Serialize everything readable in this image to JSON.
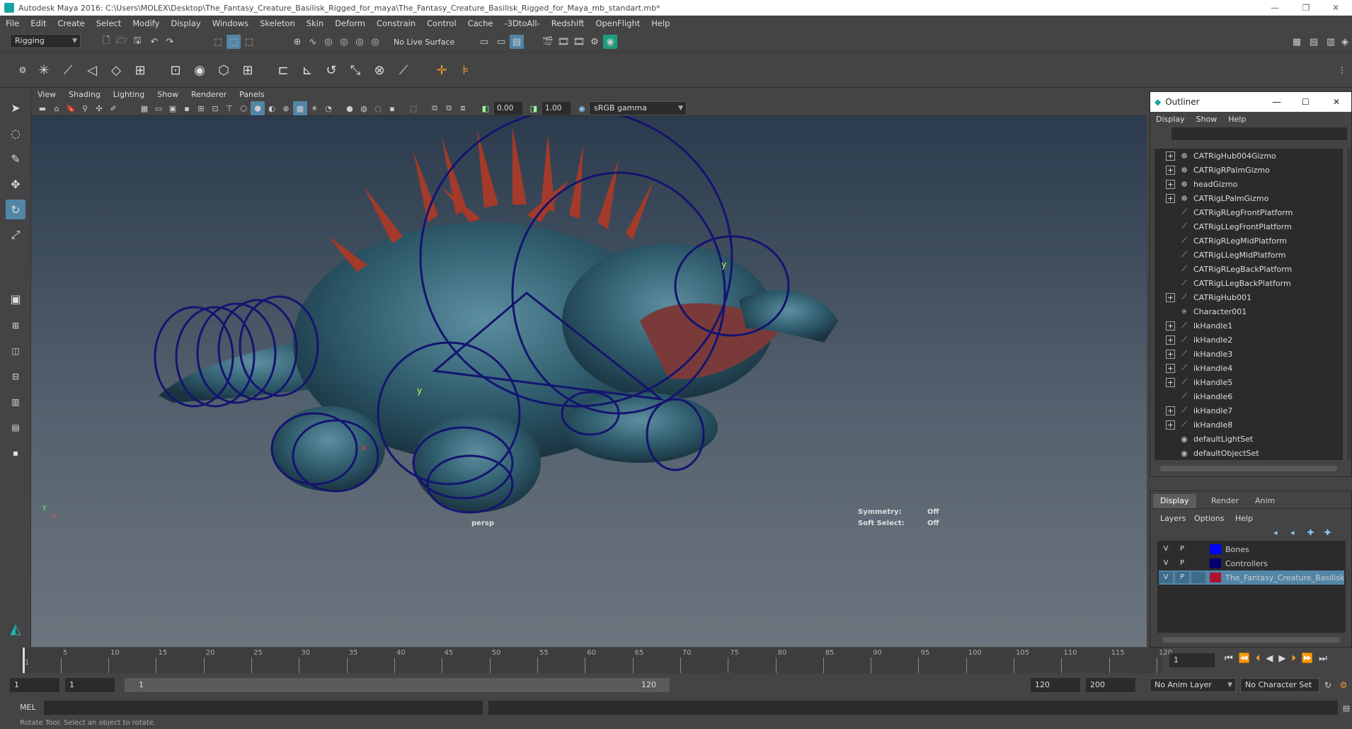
{
  "window": {
    "title": "Autodesk Maya 2016: C:\\Users\\MOLEX\\Desktop\\The_Fantasy_Creature_Basilisk_Rigged_for_maya\\The_Fantasy_Creature_Basilisk_Rigged_for_Maya_mb_standart.mb*",
    "minimize": "—",
    "restore": "❐",
    "close": "✕"
  },
  "menubar": [
    "File",
    "Edit",
    "Create",
    "Select",
    "Modify",
    "Display",
    "Windows",
    "Skeleton",
    "Skin",
    "Deform",
    "Constrain",
    "Control",
    "Cache",
    "-3DtoAll-",
    "Redshift",
    "OpenFlight",
    "Help"
  ],
  "shelf": {
    "menuset": "Rigging",
    "live_surface": "No Live Surface"
  },
  "viewport": {
    "menus": [
      "View",
      "Shading",
      "Lighting",
      "Show",
      "Renderer",
      "Panels"
    ],
    "exposure": "0.00",
    "gamma": "1.00",
    "colorspace": "sRGB gamma",
    "camera_label": "persp",
    "symmetry_label": "Symmetry:",
    "symmetry_value": "Off",
    "soft_select_label": "Soft Select:",
    "soft_select_value": "Off",
    "axis_y": "y",
    "axis_x": "x"
  },
  "outliner": {
    "title": "Outliner",
    "menus": [
      "Display",
      "Show",
      "Help"
    ],
    "items": [
      {
        "label": "CATRigHub004Gizmo",
        "expand": true,
        "icon": "gizmo-icon"
      },
      {
        "label": "CATRigRPalmGizmo",
        "expand": true,
        "icon": "gizmo-icon"
      },
      {
        "label": "headGizmo",
        "expand": true,
        "icon": "gizmo-icon"
      },
      {
        "label": "CATRigLPalmGizmo",
        "expand": true,
        "icon": "gizmo-icon"
      },
      {
        "label": "CATRigRLegFrontPlatform",
        "expand": false,
        "icon": "curve-icon"
      },
      {
        "label": "CATRigLLegFrontPlatform",
        "expand": false,
        "icon": "curve-icon"
      },
      {
        "label": "CATRigRLegMidPlatform",
        "expand": false,
        "icon": "curve-icon"
      },
      {
        "label": "CATRigLLegMidPlatform",
        "expand": false,
        "icon": "curve-icon"
      },
      {
        "label": "CATRigRLegBackPlatform",
        "expand": false,
        "icon": "curve-icon"
      },
      {
        "label": "CATRigLLegBackPlatform",
        "expand": false,
        "icon": "curve-icon"
      },
      {
        "label": "CATRigHub001",
        "expand": true,
        "icon": "curve-icon"
      },
      {
        "label": "Character001",
        "expand": false,
        "icon": "character-icon"
      },
      {
        "label": "ikHandle1",
        "expand": true,
        "icon": "ik-handle-icon"
      },
      {
        "label": "ikHandle2",
        "expand": true,
        "icon": "ik-handle-icon"
      },
      {
        "label": "ikHandle3",
        "expand": true,
        "icon": "ik-handle-icon"
      },
      {
        "label": "ikHandle4",
        "expand": true,
        "icon": "ik-handle-icon"
      },
      {
        "label": "ikHandle5",
        "expand": true,
        "icon": "ik-handle-icon"
      },
      {
        "label": "ikHandle6",
        "expand": false,
        "icon": "ik-handle-icon"
      },
      {
        "label": "ikHandle7",
        "expand": true,
        "icon": "ik-handle-icon"
      },
      {
        "label": "ikHandle8",
        "expand": true,
        "icon": "ik-handle-icon"
      },
      {
        "label": "defaultLightSet",
        "expand": false,
        "icon": "set-icon"
      },
      {
        "label": "defaultObjectSet",
        "expand": false,
        "icon": "set-icon"
      }
    ]
  },
  "layers": {
    "tabs": [
      "Display",
      "Render",
      "Anim"
    ],
    "menus": [
      "Layers",
      "Options",
      "Help"
    ],
    "rows": [
      {
        "v": "V",
        "p": "P",
        "color": "#0000ff",
        "name": "Bones",
        "selected": false
      },
      {
        "v": "V",
        "p": "P",
        "color": "#000070",
        "name": "Controllers",
        "selected": false
      },
      {
        "v": "V",
        "p": "P",
        "color": "#b01030",
        "name": "The_Fantasy_Creature_Basilisk_R",
        "selected": true
      }
    ]
  },
  "timeline": {
    "ticks": [
      "1",
      "5",
      "10",
      "15",
      "20",
      "25",
      "30",
      "35",
      "40",
      "45",
      "50",
      "55",
      "60",
      "65",
      "70",
      "75",
      "80",
      "85",
      "90",
      "95",
      "100",
      "105",
      "110",
      "115",
      "120"
    ],
    "current_frame": "1"
  },
  "range": {
    "start": "1",
    "playback_start": "1",
    "slider_start": "1",
    "slider_end": "120",
    "playback_end": "120",
    "end": "200",
    "anim_layer": "No Anim Layer",
    "character_set": "No Character Set"
  },
  "command": {
    "label": "MEL"
  },
  "help_line": "Rotate Tool: Select an object to rotate."
}
